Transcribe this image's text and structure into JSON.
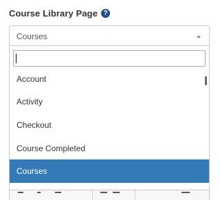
{
  "field": {
    "label": "Course Library Page",
    "help_glyph": "?"
  },
  "select": {
    "value": "Courses",
    "search_value": ""
  },
  "options": [
    {
      "label": "Account",
      "selected": false
    },
    {
      "label": "Activity",
      "selected": false
    },
    {
      "label": "Checkout",
      "selected": false
    },
    {
      "label": "Course Completed",
      "selected": false
    },
    {
      "label": "Courses",
      "selected": true
    }
  ],
  "colors": {
    "selected_bg": "#337ab7",
    "help_icon_bg": "#1f4d8a"
  },
  "icons": {
    "help": "question-circle-icon",
    "dropdown_arrow": "caret-up-icon"
  }
}
